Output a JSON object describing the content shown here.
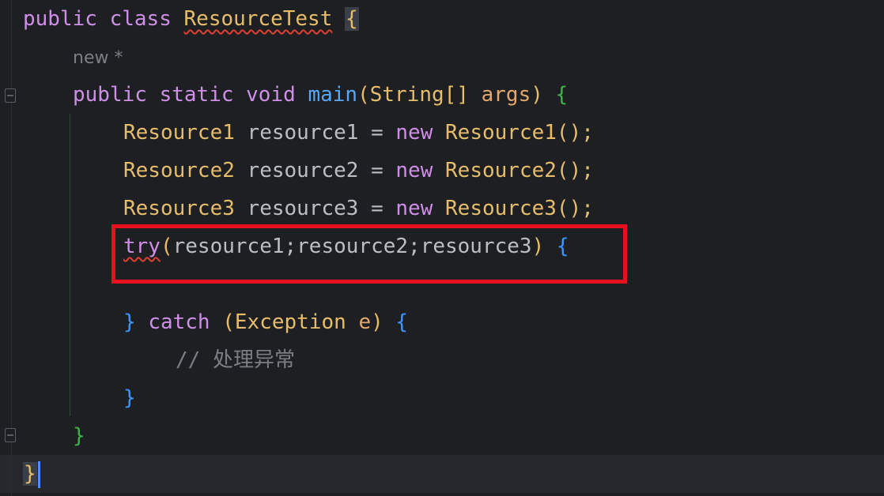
{
  "editor": {
    "theme_colors": {
      "background": "#1e1f22",
      "keyword": "#cf8ee8",
      "class_name": "#e8bd6a",
      "method": "#56a8f5",
      "parameter": "#e3a86b",
      "comment": "#7a7e85",
      "highlight_box": "#e8101c"
    },
    "lines": {
      "l1": {
        "kw_public": "public",
        "kw_class": "class",
        "class_name": "ResourceTest",
        "brace": "{"
      },
      "l2": {
        "hint": "new *"
      },
      "l3": {
        "kw_public": "public",
        "kw_static": "static",
        "kw_void": "void",
        "method": "main",
        "paren_open": "(",
        "type": "String[]",
        "param": "args",
        "paren_close": ")",
        "brace": "{"
      },
      "l4": {
        "type": "Resource1",
        "var": "resource1",
        "eq": "=",
        "kw_new": "new",
        "ctor": "Resource1",
        "tail": "();"
      },
      "l5": {
        "type": "Resource2",
        "var": "resource2",
        "eq": "=",
        "kw_new": "new",
        "ctor": "Resource2",
        "tail": "();"
      },
      "l6": {
        "type": "Resource3",
        "var": "resource3",
        "eq": "=",
        "kw_new": "new",
        "ctor": "Resource3",
        "tail": "();"
      },
      "l7": {
        "kw_try": "try",
        "paren_open": "(",
        "resources": "resource1;resource2;resource3",
        "paren_close": ")",
        "brace": "{"
      },
      "l9": {
        "brace_close": "}",
        "kw_catch": "catch",
        "paren_open": "(",
        "type": "Exception",
        "param": "e",
        "paren_close": ")",
        "brace": "{"
      },
      "l10": {
        "comment": "// 处理异常"
      },
      "l11": {
        "brace": "}"
      },
      "l12": {
        "brace": "}"
      },
      "l13": {
        "brace": "}"
      }
    }
  }
}
